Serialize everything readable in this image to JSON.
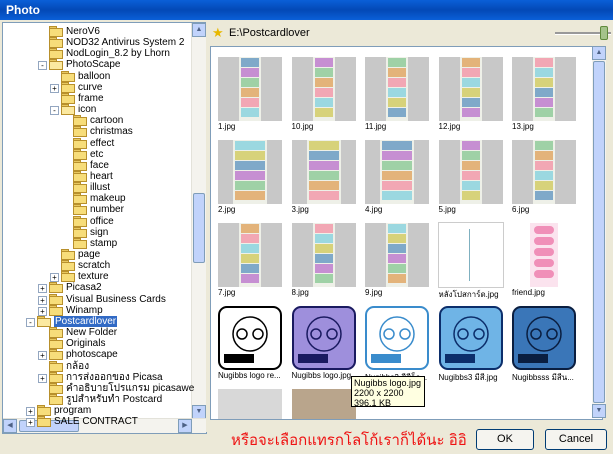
{
  "window": {
    "title": "Photo"
  },
  "tree": {
    "items": [
      {
        "label": "NeroV6",
        "depth": 3,
        "expander": ""
      },
      {
        "label": "NOD32 Antivirus System 2",
        "depth": 3,
        "expander": ""
      },
      {
        "label": "NodLogin_8.2 by Lhorn",
        "depth": 3,
        "expander": ""
      },
      {
        "label": "PhotoScape",
        "depth": 3,
        "expander": "-"
      },
      {
        "label": "balloon",
        "depth": 4,
        "expander": ""
      },
      {
        "label": "curve",
        "depth": 4,
        "expander": "+"
      },
      {
        "label": "frame",
        "depth": 4,
        "expander": ""
      },
      {
        "label": "icon",
        "depth": 4,
        "expander": "-"
      },
      {
        "label": "cartoon",
        "depth": 5,
        "expander": ""
      },
      {
        "label": "christmas",
        "depth": 5,
        "expander": ""
      },
      {
        "label": "effect",
        "depth": 5,
        "expander": ""
      },
      {
        "label": "etc",
        "depth": 5,
        "expander": ""
      },
      {
        "label": "face",
        "depth": 5,
        "expander": ""
      },
      {
        "label": "heart",
        "depth": 5,
        "expander": ""
      },
      {
        "label": "illust",
        "depth": 5,
        "expander": ""
      },
      {
        "label": "makeup",
        "depth": 5,
        "expander": ""
      },
      {
        "label": "number",
        "depth": 5,
        "expander": ""
      },
      {
        "label": "office",
        "depth": 5,
        "expander": ""
      },
      {
        "label": "sign",
        "depth": 5,
        "expander": ""
      },
      {
        "label": "stamp",
        "depth": 5,
        "expander": ""
      },
      {
        "label": "page",
        "depth": 4,
        "expander": ""
      },
      {
        "label": "scratch",
        "depth": 4,
        "expander": ""
      },
      {
        "label": "texture",
        "depth": 4,
        "expander": "+"
      },
      {
        "label": "Picasa2",
        "depth": 3,
        "expander": "+"
      },
      {
        "label": "Visual Business Cards",
        "depth": 3,
        "expander": "+"
      },
      {
        "label": "Winamp",
        "depth": 3,
        "expander": "+"
      },
      {
        "label": "Postcardlover",
        "depth": 2,
        "expander": "-",
        "selected": true
      },
      {
        "label": "New Folder",
        "depth": 3,
        "expander": ""
      },
      {
        "label": "Originals",
        "depth": 3,
        "expander": ""
      },
      {
        "label": "photoscape",
        "depth": 3,
        "expander": "+"
      },
      {
        "label": "กล้อง",
        "depth": 3,
        "expander": ""
      },
      {
        "label": "การส่งออกของ Picasa",
        "depth": 3,
        "expander": "+"
      },
      {
        "label": "คำอธิบายโปรแกรม picasawe",
        "depth": 3,
        "expander": ""
      },
      {
        "label": "รูปสำหรับทำ Postcard",
        "depth": 3,
        "expander": ""
      },
      {
        "label": "program",
        "depth": 2,
        "expander": "+"
      },
      {
        "label": "SALE CONTRACT",
        "depth": 2,
        "expander": "+"
      }
    ]
  },
  "pathbar": {
    "path": "E:\\Postcardlover",
    "star_icon": "favorite-star-icon"
  },
  "files": [
    {
      "name": "1.jpg",
      "kind": "strip"
    },
    {
      "name": "10.jpg",
      "kind": "strip"
    },
    {
      "name": "11.jpg",
      "kind": "strip"
    },
    {
      "name": "12.jpg",
      "kind": "strip"
    },
    {
      "name": "13.jpg",
      "kind": "strip"
    },
    {
      "name": "2.jpg",
      "kind": "strip"
    },
    {
      "name": "3.jpg",
      "kind": "strip"
    },
    {
      "name": "4.jpg",
      "kind": "strip"
    },
    {
      "name": "5.jpg",
      "kind": "strip"
    },
    {
      "name": "6.jpg",
      "kind": "strip"
    },
    {
      "name": "7.jpg",
      "kind": "strip"
    },
    {
      "name": "8.jpg",
      "kind": "strip"
    },
    {
      "name": "9.jpg",
      "kind": "strip"
    },
    {
      "name": "หลังโปสการ์ด.jpg",
      "kind": "white"
    },
    {
      "name": "friend.jpg",
      "kind": "pink"
    },
    {
      "name": "Nugibbs logo re...",
      "kind": "logo-white"
    },
    {
      "name": "Nugibbs logo.jpg",
      "kind": "logo-purple"
    },
    {
      "name": "Nugibbs2 สีสีอ็ก...",
      "kind": "logo-lightblue"
    },
    {
      "name": "Nugibbs3 มีสี.jpg",
      "kind": "logo-blue"
    },
    {
      "name": "Nugibbsss มีสีน...",
      "kind": "logo-darkblue"
    }
  ],
  "tooltip": {
    "line1": "Nugibbs logo.jpg",
    "line2": "2200 x 2200",
    "line3": "396.1 KB"
  },
  "footer": {
    "note": "หรือจะเลือกแทรกโลโก้เราก็ได้นะ อิอิ",
    "ok_label": "OK",
    "cancel_label": "Cancel"
  },
  "colors": {
    "note": "#ee1111",
    "titlebar": "#0a5fd8",
    "selection": "#316ac5"
  }
}
